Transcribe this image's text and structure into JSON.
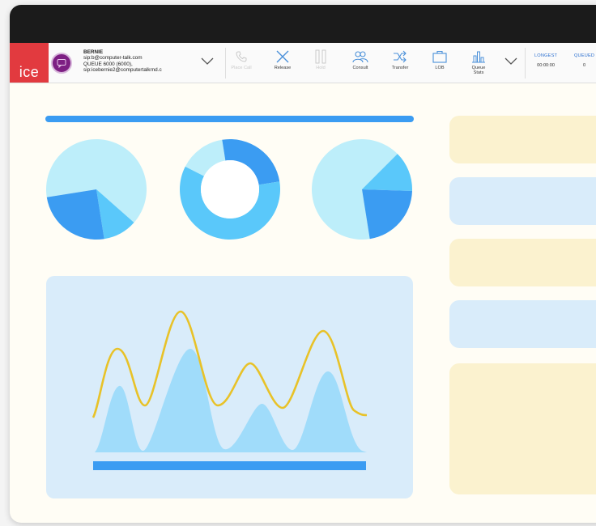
{
  "app": {
    "logo_text": "ice"
  },
  "agent": {
    "name": "BERNIE",
    "sip": "sip:b@computer-talk.com",
    "queue": "QUEUE 6000 (6000),",
    "sip2": "sip:icebernie2@computertalkrnd.c"
  },
  "toolbar": {
    "buttons": [
      {
        "label": "Place Call",
        "icon": "phone-icon",
        "enabled": false
      },
      {
        "label": "Release",
        "icon": "close-icon",
        "enabled": true
      },
      {
        "label": "Hold",
        "icon": "pause-icon",
        "enabled": false
      },
      {
        "label": "Consult",
        "icon": "consult-icon",
        "enabled": true
      },
      {
        "label": "Transfer",
        "icon": "transfer-icon",
        "enabled": true
      },
      {
        "label": "LOB",
        "icon": "briefcase-icon",
        "enabled": true
      },
      {
        "label": "Queue Stats",
        "icon": "bar-chart-icon",
        "enabled": true
      }
    ]
  },
  "stats": {
    "longest_label": "LONGEST",
    "longest_value": "00:00:00",
    "queued_label": "QUEUED",
    "queued_value": "0"
  },
  "colors": {
    "titlebar": "#1b1b1b",
    "logo": "#e23a3f",
    "accent": "#3b9cf2",
    "light_blue": "#bdeefa",
    "mid_blue": "#5ac8fa",
    "panel_blue": "#d9ecfa",
    "panel_yellow": "#fbf2cf",
    "wave_line": "#e8c228"
  },
  "chart_data": [
    {
      "type": "pie",
      "values": [
        64,
        11,
        25
      ],
      "colors": [
        "#bdeefa",
        "#5ac8fa",
        "#3b9cf2"
      ]
    },
    {
      "type": "donut",
      "values": [
        15,
        25,
        60
      ],
      "colors": [
        "#bdeefa",
        "#3b9cf2",
        "#5ac8fa"
      ]
    },
    {
      "type": "pie",
      "values": [
        65,
        13,
        22
      ],
      "colors": [
        "#bdeefa",
        "#5ac8fa",
        "#3b9cf2"
      ]
    },
    {
      "type": "area",
      "series_count": 2,
      "colors": [
        "#a0dcfa",
        "#e8c228"
      ]
    }
  ]
}
